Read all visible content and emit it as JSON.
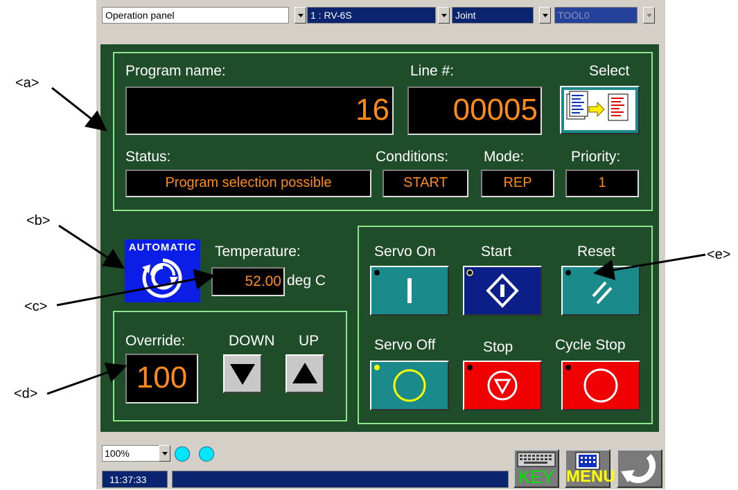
{
  "toolbar": {
    "panel_select": "Operation panel",
    "robot_select": "1 : RV-6S",
    "jog_mode": "Joint",
    "tool_select": "TOOL0"
  },
  "program": {
    "name_label": "Program name:",
    "name_value": "16",
    "line_label": "Line #:",
    "line_value": "00005",
    "select_label": "Select",
    "status_label": "Status:",
    "status_value": "Program selection possible",
    "conditions_label": "Conditions:",
    "conditions_value": "START",
    "mode_label": "Mode:",
    "mode_value": "REP",
    "priority_label": "Priority:",
    "priority_value": "1"
  },
  "automatic": {
    "badge": "AUTOMATIC",
    "temperature_label": "Temperature:",
    "temperature_value": "52.00",
    "temperature_unit": "deg C"
  },
  "override": {
    "label": "Override:",
    "down_label": "DOWN",
    "up_label": "UP",
    "value": "100"
  },
  "controls": {
    "servo_on": "Servo On",
    "start": "Start",
    "reset": "Reset",
    "servo_off": "Servo Off",
    "stop": "Stop",
    "cycle_stop": "Cycle Stop"
  },
  "callouts": {
    "a": "<a>",
    "b": "<b>",
    "c": "<c>",
    "d": "<d>",
    "e": "<e>"
  },
  "bottom": {
    "zoom": "100%",
    "time": "11:37:33",
    "key_label": "KEY",
    "menu_label": "MENU"
  },
  "colors": {
    "panel_bg": "#1f4d2a",
    "frame": "#8ce68c",
    "lcd_text": "#ff8c1a",
    "teal_button": "#1a8a8a",
    "navy_button": "#0c1f88",
    "red_button": "#f00000"
  }
}
